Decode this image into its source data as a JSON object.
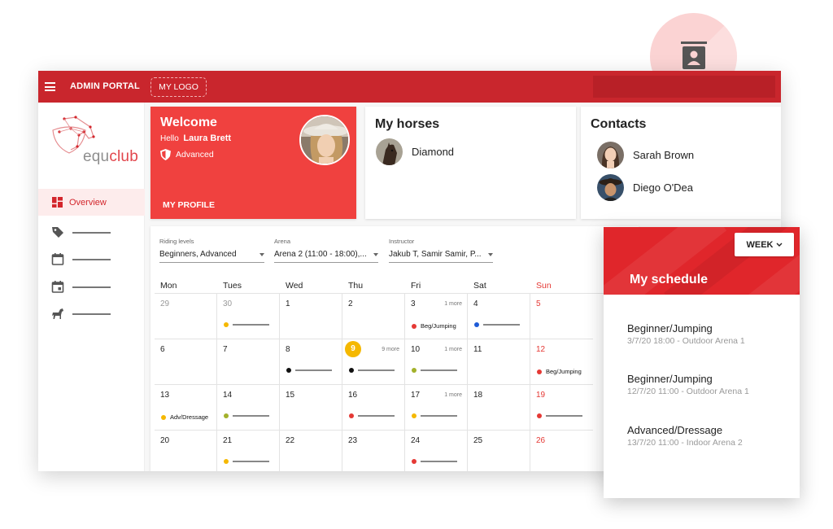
{
  "topbar": {
    "title": "ADMIN PORTAL",
    "logo_placeholder": "MY LOGO"
  },
  "sidebar": {
    "brand": {
      "part1": "equ",
      "part2": "club"
    },
    "active_item": "Overview",
    "items": [
      "tag-icon",
      "calendar-icon",
      "calendar-day-icon",
      "horse-icon"
    ]
  },
  "welcome": {
    "title": "Welcome",
    "hello": "Hello",
    "user_name": "Laura Brett",
    "level": "Advanced",
    "profile_link": "MY PROFILE"
  },
  "horses": {
    "title": "My horses",
    "items": [
      {
        "name": "Diamond"
      }
    ]
  },
  "contacts": {
    "title": "Contacts",
    "items": [
      {
        "name": "Sarah Brown"
      },
      {
        "name": "Diego O'Dea"
      }
    ]
  },
  "calendar": {
    "filters": [
      {
        "label": "Riding levels",
        "value": "Beginners, Advanced"
      },
      {
        "label": "Arena",
        "value": "Arena 2 (11:00 - 18:00),..."
      },
      {
        "label": "Instructor",
        "value": "Jakub T, Samir Samir, P..."
      }
    ],
    "days": [
      "Mon",
      "Tues",
      "Wed",
      "Thu",
      "Fri",
      "Sat",
      "Sun"
    ],
    "weeks": [
      [
        {
          "d": "29",
          "style": "muted"
        },
        {
          "d": "30",
          "style": "muted",
          "ev": {
            "color": "#f5b800"
          }
        },
        {
          "d": "1"
        },
        {
          "d": "2"
        },
        {
          "d": "3",
          "more": "1 more",
          "ev": {
            "color": "#e53935",
            "text": "Beg/Jumping"
          }
        },
        {
          "d": "4",
          "ev": {
            "color": "#1e5bd6"
          }
        },
        {
          "d": "5",
          "style": "red"
        }
      ],
      [
        {
          "d": "6"
        },
        {
          "d": "7"
        },
        {
          "d": "8",
          "ev": {
            "color": "#111111"
          }
        },
        {
          "d": "9",
          "style": "today",
          "more": "9 more",
          "ev": {
            "color": "#111111"
          }
        },
        {
          "d": "10",
          "more": "1 more",
          "ev": {
            "color": "#a3b12b"
          }
        },
        {
          "d": "11"
        },
        {
          "d": "12",
          "style": "red",
          "ev": {
            "color": "#e53935",
            "text": "Beg/Jumping"
          }
        }
      ],
      [
        {
          "d": "13",
          "ev": {
            "color": "#f5b800",
            "text": "Adv/Dressage"
          }
        },
        {
          "d": "14",
          "ev": {
            "color": "#a3b12b"
          }
        },
        {
          "d": "15"
        },
        {
          "d": "16",
          "ev": {
            "color": "#e53935"
          }
        },
        {
          "d": "17",
          "more": "1 more",
          "ev": {
            "color": "#f5b800"
          }
        },
        {
          "d": "18"
        },
        {
          "d": "19",
          "style": "red",
          "ev": {
            "color": "#e53935"
          }
        }
      ],
      [
        {
          "d": "20"
        },
        {
          "d": "21",
          "ev": {
            "color": "#f5b800"
          }
        },
        {
          "d": "22"
        },
        {
          "d": "23"
        },
        {
          "d": "24",
          "ev": {
            "color": "#e53935"
          }
        },
        {
          "d": "25"
        },
        {
          "d": "26",
          "style": "red"
        }
      ]
    ]
  },
  "schedule": {
    "title": "My schedule",
    "view": "WEEK",
    "items": [
      {
        "title": "Beginner/Jumping",
        "detail": "3/7/20 18:00 - Outdoor Arena 1"
      },
      {
        "title": "Beginner/Jumping",
        "detail": "12/7/20 11:00 - Outdoor Arena 1"
      },
      {
        "title": "Advanced/Dressage",
        "detail": "13/7/20 11:00 - Indoor Arena 2"
      }
    ]
  },
  "colors": {
    "brand_red": "#c9262d",
    "welcome_red": "#f0413f",
    "today": "#f5b800",
    "weekend": "#e53935"
  }
}
